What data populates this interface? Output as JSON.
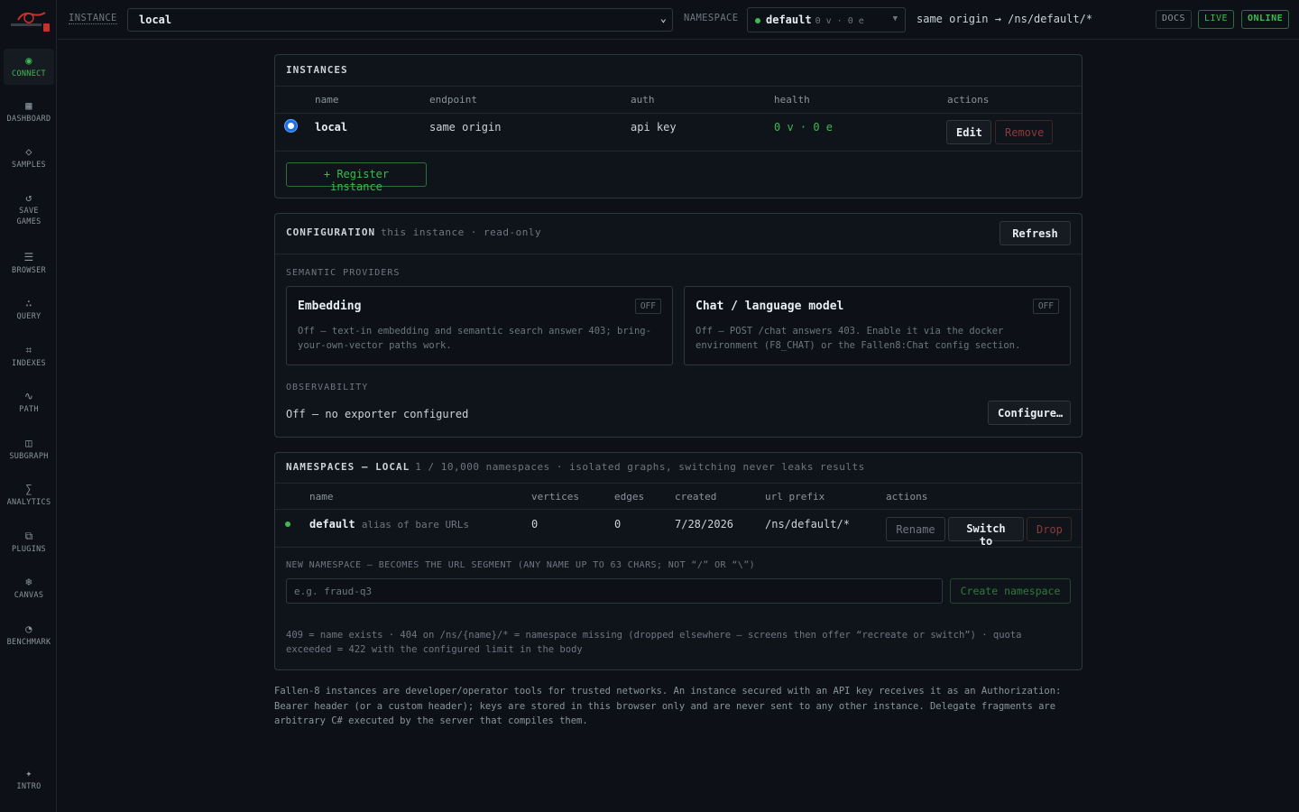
{
  "sidebar": {
    "items": [
      {
        "label": "CONNECT",
        "icon": "◉"
      },
      {
        "label": "DASHBOARD",
        "icon": "▦"
      },
      {
        "label": "SAMPLES",
        "icon": "◇"
      },
      {
        "label": "SAVE GAMES",
        "icon": "↺"
      },
      {
        "label": "BROWSER",
        "icon": "☰"
      },
      {
        "label": "QUERY",
        "icon": "∴"
      },
      {
        "label": "INDEXES",
        "icon": "⌗"
      },
      {
        "label": "PATH",
        "icon": "∿"
      },
      {
        "label": "SUBGRAPH",
        "icon": "◫"
      },
      {
        "label": "ANALYTICS",
        "icon": "∑"
      },
      {
        "label": "PLUGINS",
        "icon": "⧉"
      },
      {
        "label": "CANVAS",
        "icon": "❄"
      },
      {
        "label": "BENCHMARK",
        "icon": "◔"
      }
    ],
    "intro": {
      "label": "INTRO",
      "icon": "✦"
    }
  },
  "topbar": {
    "instance_label": "INSTANCE",
    "instance_value": "local",
    "namespace_label": "NAMESPACE",
    "namespace_value": "default",
    "namespace_counts": "0 v · 0 e",
    "route": "same origin → /ns/default/*",
    "docs": "DOCS",
    "live": "LIVE",
    "online": "ONLINE"
  },
  "instances": {
    "title": "INSTANCES",
    "headers": {
      "name": "name",
      "endpoint": "endpoint",
      "auth": "auth",
      "health": "health",
      "actions": "actions"
    },
    "row": {
      "name": "local",
      "endpoint": "same origin",
      "auth": "api key",
      "health": "0 v · 0 e",
      "edit": "Edit",
      "remove": "Remove"
    },
    "register": "+ Register instance"
  },
  "configuration": {
    "title": "CONFIGURATION",
    "subtitle": "this instance · read-only",
    "refresh": "Refresh",
    "semantic_label": "SEMANTIC PROVIDERS",
    "embedding": {
      "title": "Embedding",
      "status": "OFF",
      "desc": "Off — text-in embedding and semantic search answer 403; bring-your-own-vector paths work."
    },
    "chat": {
      "title": "Chat / language model",
      "status": "OFF",
      "desc": "Off — POST /chat answers 403. Enable it via the docker environment (F8_CHAT) or the Fallen8:Chat config section."
    },
    "observability_label": "OBSERVABILITY",
    "observability_value": "Off — no exporter configured",
    "configure": "Configure…"
  },
  "namespaces": {
    "title": "NAMESPACES — LOCAL",
    "subtitle": "1 / 10,000 namespaces · isolated graphs, switching never leaks results",
    "headers": {
      "name": "name",
      "vertices": "vertices",
      "edges": "edges",
      "created": "created",
      "prefix": "url prefix",
      "actions": "actions"
    },
    "row": {
      "name": "default",
      "alias": "alias of bare URLs",
      "vertices": "0",
      "edges": "0",
      "created": "7/28/2026",
      "prefix": "/ns/default/*",
      "rename": "Rename",
      "switch": "Switch to",
      "drop": "Drop"
    },
    "new_label": "NEW NAMESPACE — BECOMES THE URL SEGMENT (ANY NAME UP TO 63 CHARS; NOT “/” OR “\\”)",
    "placeholder": "e.g. fraud-q3",
    "create": "Create namespace",
    "help": "409 = name exists · 404 on /ns/{name}/* = namespace missing (dropped elsewhere — screens then offer “recreate or switch”) · quota exceeded = 422 with the configured limit in the body"
  },
  "footer": "Fallen-8 instances are developer/operator tools for trusted networks. An instance secured with an API key receives it as an Authorization: Bearer header (or a custom header); keys are stored in this browser only and are never sent to any other instance. Delegate fragments are arbitrary C# executed by the server that compiles them."
}
